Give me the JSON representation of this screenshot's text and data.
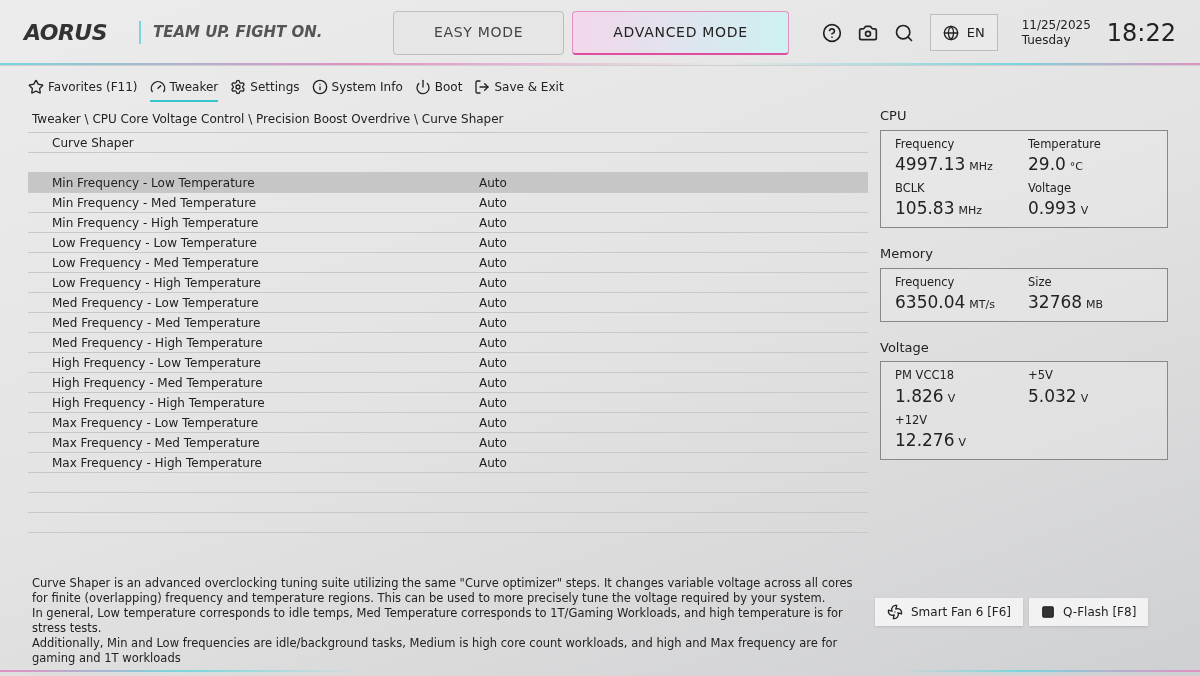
{
  "header": {
    "logo": "AORUS",
    "slogan": "TEAM UP. FIGHT ON.",
    "modes": [
      {
        "label": "EASY MODE",
        "selected": false
      },
      {
        "label": "ADVANCED MODE",
        "selected": true
      }
    ],
    "language": "EN",
    "date": "11/25/2025",
    "day": "Tuesday",
    "time": "18:22"
  },
  "menu": [
    {
      "label": "Favorites (F11)",
      "selected": false
    },
    {
      "label": "Tweaker",
      "selected": true
    },
    {
      "label": "Settings",
      "selected": false
    },
    {
      "label": "System Info",
      "selected": false
    },
    {
      "label": "Boot",
      "selected": false
    },
    {
      "label": "Save & Exit",
      "selected": false
    }
  ],
  "breadcrumb": "Tweaker \\ CPU Core Voltage Control \\ Precision Boost Overdrive \\ Curve Shaper",
  "section_title": "Curve Shaper",
  "settings": [
    {
      "name": "Min Frequency - Low Temperature",
      "value": "Auto",
      "selected": true
    },
    {
      "name": "Min Frequency - Med Temperature",
      "value": "Auto",
      "selected": false
    },
    {
      "name": "Min Frequency - High Temperature",
      "value": "Auto",
      "selected": false
    },
    {
      "name": "Low Frequency - Low Temperature",
      "value": "Auto",
      "selected": false
    },
    {
      "name": "Low Frequency - Med Temperature",
      "value": "Auto",
      "selected": false
    },
    {
      "name": "Low Frequency - High Temperature",
      "value": "Auto",
      "selected": false
    },
    {
      "name": "Med Frequency - Low Temperature",
      "value": "Auto",
      "selected": false
    },
    {
      "name": "Med Frequency - Med Temperature",
      "value": "Auto",
      "selected": false
    },
    {
      "name": "Med Frequency - High Temperature",
      "value": "Auto",
      "selected": false
    },
    {
      "name": "High Frequency - Low Temperature",
      "value": "Auto",
      "selected": false
    },
    {
      "name": "High Frequency - Med Temperature",
      "value": "Auto",
      "selected": false
    },
    {
      "name": "High Frequency - High Temperature",
      "value": "Auto",
      "selected": false
    },
    {
      "name": "Max Frequency - Low Temperature",
      "value": "Auto",
      "selected": false
    },
    {
      "name": "Max Frequency - Med Temperature",
      "value": "Auto",
      "selected": false
    },
    {
      "name": "Max Frequency - High Temperature",
      "value": "Auto",
      "selected": false
    }
  ],
  "description": [
    "Curve Shaper is an advanced overclocking tuning suite utilizing the same \"Curve optimizer\" steps. It changes variable voltage across all cores for finite (overlapping) frequency and temperature regions. This can be used to more precisely tune the voltage required by your system.",
    "In general, Low temperature corresponds to idle temps, Med Temperature corresponds to 1T/Gaming Workloads, and high temperature is for stress tests.",
    "Additionally, Min and Low frequencies are idle/background tasks, Medium is high core count workloads, and high and Max frequency are for gaming and 1T workloads"
  ],
  "monitor": [
    {
      "title": "CPU",
      "items": [
        {
          "label": "Frequency",
          "value": "4997.13",
          "unit": "MHz"
        },
        {
          "label": "Temperature",
          "value": "29.0",
          "unit": "°C"
        },
        {
          "label": "BCLK",
          "value": "105.83",
          "unit": "MHz"
        },
        {
          "label": "Voltage",
          "value": "0.993",
          "unit": "V"
        }
      ]
    },
    {
      "title": "Memory",
      "items": [
        {
          "label": "Frequency",
          "value": "6350.04",
          "unit": "MT/s"
        },
        {
          "label": "Size",
          "value": "32768",
          "unit": "MB"
        }
      ]
    },
    {
      "title": "Voltage",
      "items": [
        {
          "label": "PM VCC18",
          "value": "1.826",
          "unit": "V"
        },
        {
          "label": "+5V",
          "value": "5.032",
          "unit": "V"
        },
        {
          "label": "+12V",
          "value": "12.276",
          "unit": "V"
        }
      ]
    }
  ],
  "buttons": [
    {
      "label": "Smart Fan 6 [F6]"
    },
    {
      "label": "Q-Flash [F8]"
    }
  ]
}
